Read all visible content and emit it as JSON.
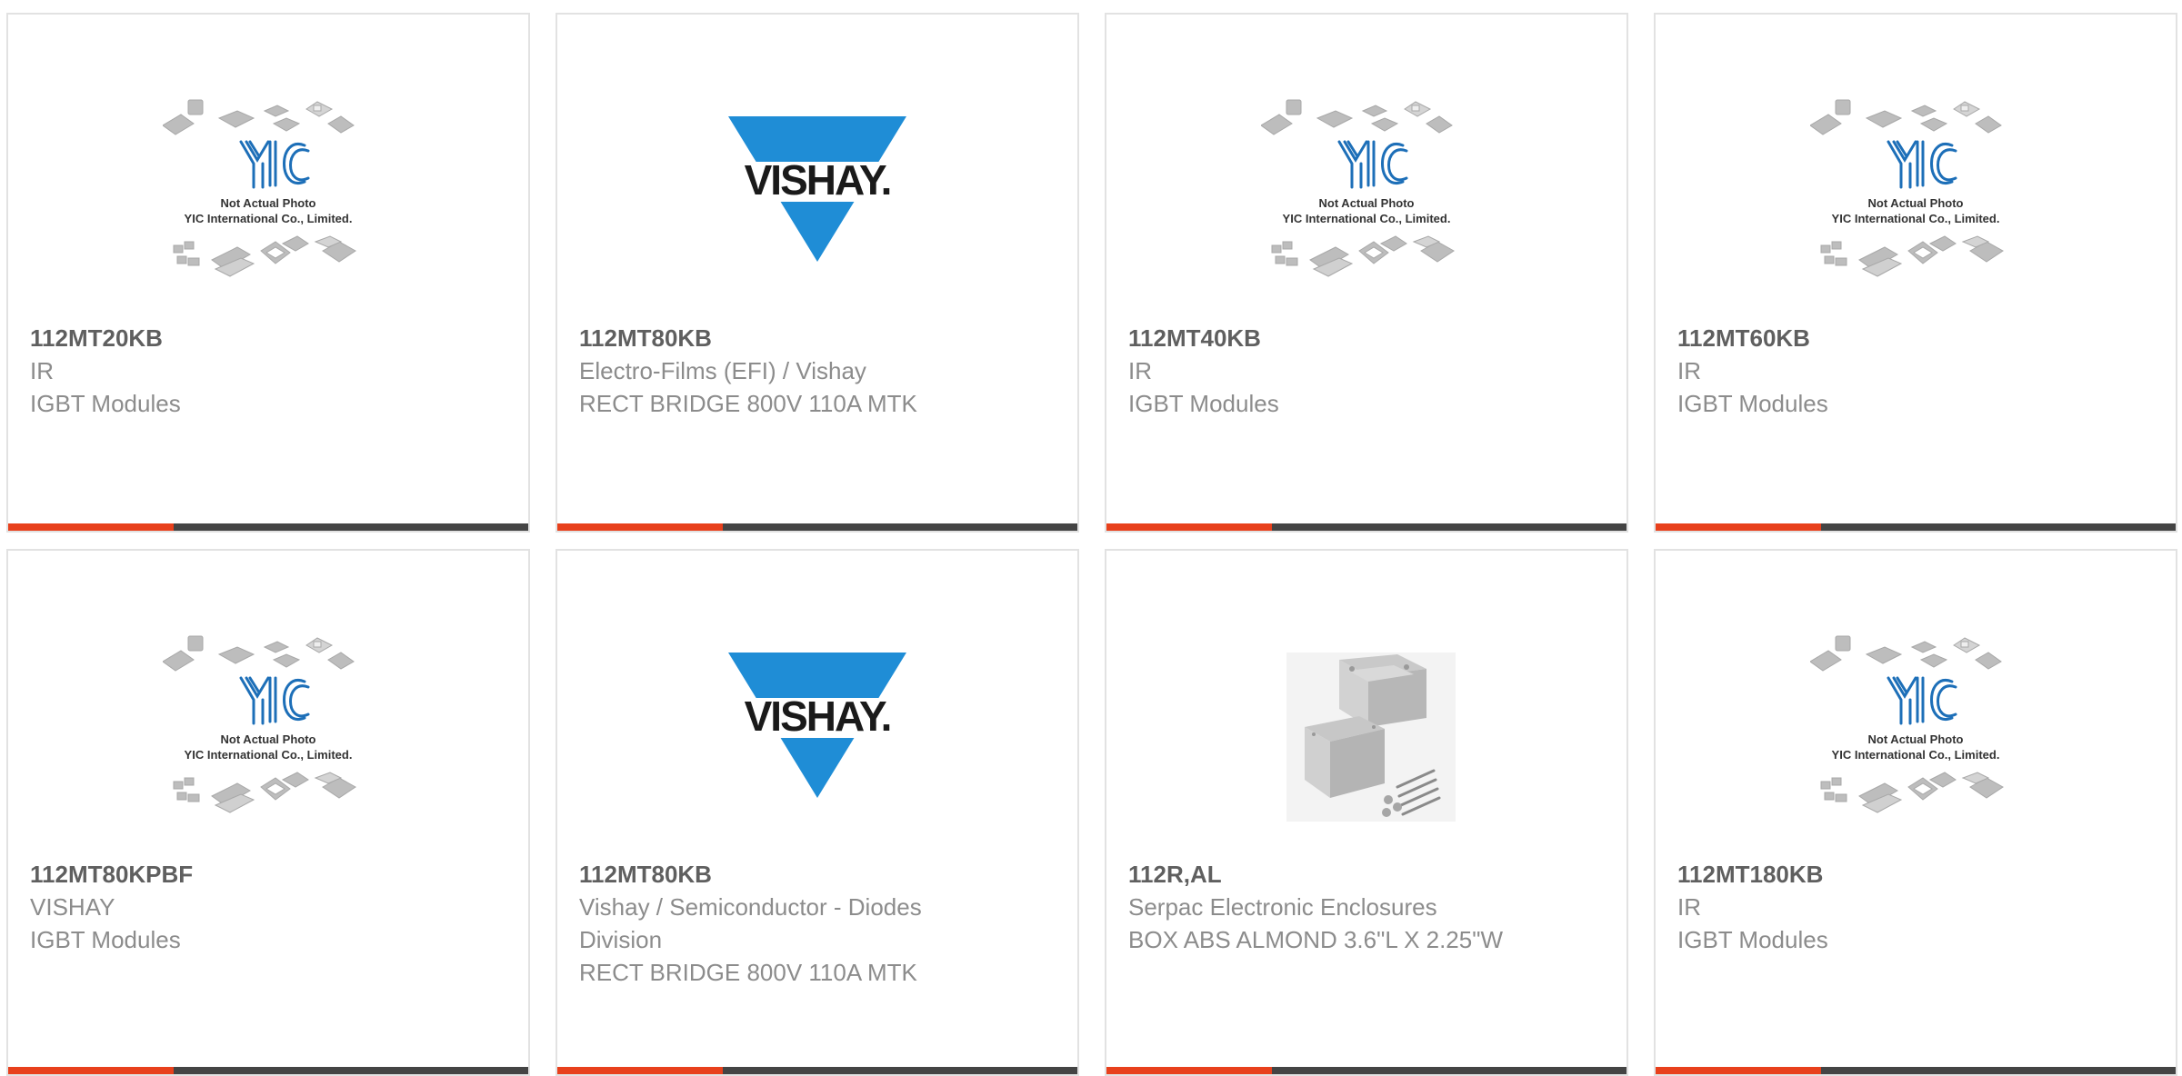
{
  "colors": {
    "accent": "#e8401c",
    "bar": "#444444",
    "vishay_blue": "#1f8dd6",
    "yic_blue": "#1d6fb8"
  },
  "products": [
    {
      "image": "yic-placeholder",
      "placeholder_lines": [
        "Not Actual Photo",
        "YIC International Co., Limited."
      ],
      "part": "112MT20KB",
      "manufacturer": "IR",
      "description": "IGBT Modules"
    },
    {
      "image": "vishay-logo",
      "logo_text": "VISHAY.",
      "part": "112MT80KB",
      "manufacturer": "Electro-Films (EFI) / Vishay",
      "description": "RECT BRIDGE 800V 110A MTK"
    },
    {
      "image": "yic-placeholder",
      "placeholder_lines": [
        "Not Actual Photo",
        "YIC International Co., Limited."
      ],
      "part": "112MT40KB",
      "manufacturer": "IR",
      "description": "IGBT Modules"
    },
    {
      "image": "yic-placeholder",
      "placeholder_lines": [
        "Not Actual Photo",
        "YIC International Co., Limited."
      ],
      "part": "112MT60KB",
      "manufacturer": "IR",
      "description": "IGBT Modules"
    },
    {
      "image": "yic-placeholder",
      "placeholder_lines": [
        "Not Actual Photo",
        "YIC International Co., Limited."
      ],
      "part": "112MT80KPBF",
      "manufacturer": "VISHAY",
      "description": "IGBT Modules"
    },
    {
      "image": "vishay-logo",
      "logo_text": "VISHAY.",
      "part": "112MT80KB",
      "manufacturer": "Vishay / Semiconductor - Diodes Division",
      "description": "RECT BRIDGE 800V 110A MTK"
    },
    {
      "image": "enclosure-photo",
      "part": "112R,AL",
      "manufacturer": "Serpac Electronic Enclosures",
      "description": "BOX ABS ALMOND 3.6\"L X 2.25\"W"
    },
    {
      "image": "yic-placeholder",
      "placeholder_lines": [
        "Not Actual Photo",
        "YIC International Co., Limited."
      ],
      "part": "112MT180KB",
      "manufacturer": "IR",
      "description": "IGBT Modules"
    }
  ]
}
